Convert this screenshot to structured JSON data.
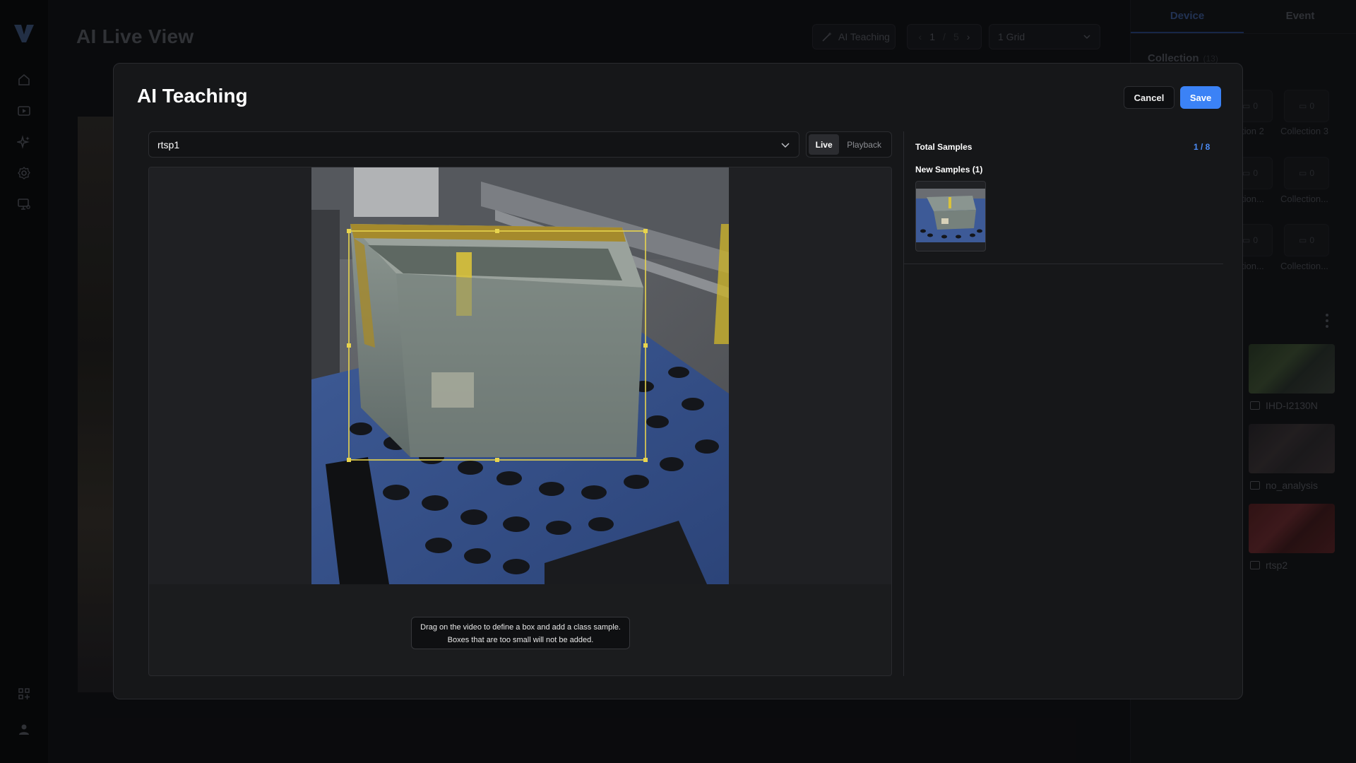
{
  "app": {
    "title": "AI Live View"
  },
  "header": {
    "ai_teaching_label": "AI Teaching",
    "page_current": "1",
    "page_separator": "/",
    "page_total": "5",
    "grid_value": "1 Grid"
  },
  "right_panel": {
    "tabs": [
      {
        "label": "Device"
      },
      {
        "label": "Event"
      }
    ],
    "collection_title": "Collection",
    "collection_count": "(13)",
    "collections": [
      {
        "label": "tion 2",
        "count": "0"
      },
      {
        "label": "Collection 3",
        "count": "0"
      },
      {
        "label": "tion...",
        "count": "0"
      },
      {
        "label": "Collection...",
        "count": "0"
      },
      {
        "label": "tion...",
        "count": "0"
      },
      {
        "label": "Collection...",
        "count": "0"
      }
    ],
    "devices": [
      {
        "name": "IHD-I2130N"
      },
      {
        "name": "no_analysis"
      },
      {
        "name": "rtsp2"
      }
    ]
  },
  "modal": {
    "title": "AI Teaching",
    "cancel_label": "Cancel",
    "save_label": "Save",
    "source_value": "rtsp1",
    "mode_live": "Live",
    "mode_playback": "Playback",
    "hint_line1": "Drag on the video to define a box and add a class sample.",
    "hint_line2": "Boxes that are too small will not be added.",
    "total_samples_label": "Total Samples",
    "total_samples_value": "1 / 8",
    "new_samples_label": "New Samples (1)"
  },
  "colors": {
    "accent": "#3b82f6",
    "selection_box": "#e8d44d",
    "modal_bg": "#161719"
  }
}
